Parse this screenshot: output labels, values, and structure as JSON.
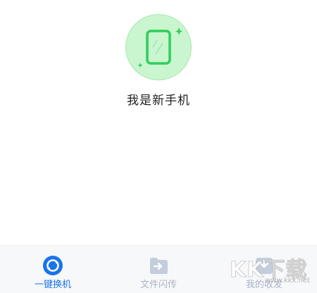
{
  "hero": {
    "label": "我是新手机",
    "icon": "phone-icon",
    "colors": {
      "circle": "#c9f5cf",
      "phone_stroke": "#2fcf59"
    }
  },
  "tabbar": {
    "tabs": [
      {
        "label": "一键换机",
        "icon": "swap-icon",
        "active": true,
        "color": "#1a73e8"
      },
      {
        "label": "文件闪传",
        "icon": "file-transfer-icon",
        "active": false,
        "color": "#c3cddc"
      },
      {
        "label": "我的收发",
        "icon": "inbox-icon",
        "active": false,
        "color": "#c3cddc"
      }
    ]
  },
  "watermark": {
    "text": "KK下载",
    "url": "www.kkx.net"
  }
}
